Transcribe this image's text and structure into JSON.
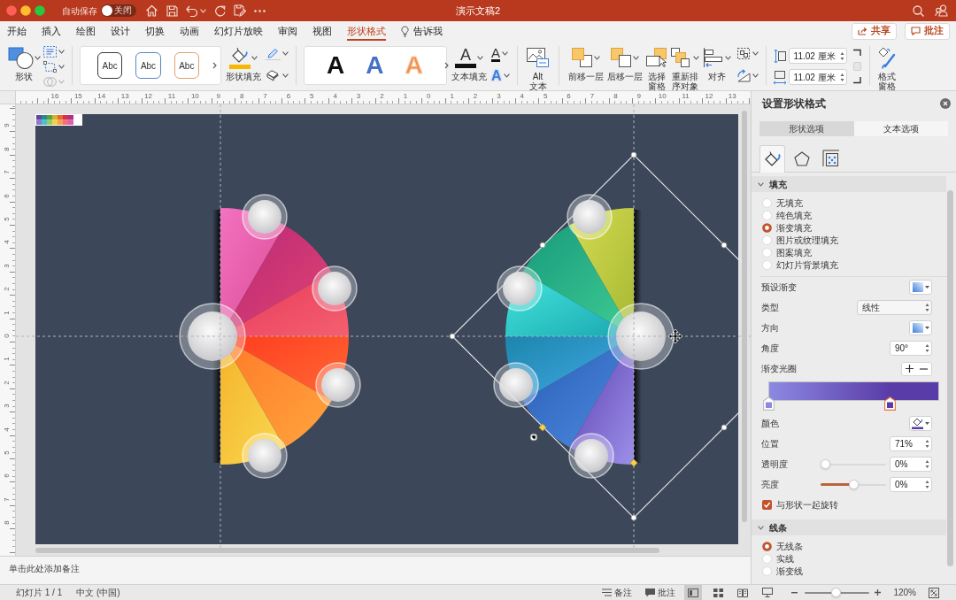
{
  "title_bar": {
    "autosave_label": "自动保存",
    "autosave": {
      "label": "关闭",
      "on": false
    },
    "title": "演示文稿2"
  },
  "tabs": [
    {
      "label": "开始",
      "selected": false
    },
    {
      "label": "插入",
      "selected": false
    },
    {
      "label": "绘图",
      "selected": false
    },
    {
      "label": "设计",
      "selected": false
    },
    {
      "label": "切换",
      "selected": false
    },
    {
      "label": "动画",
      "selected": false
    },
    {
      "label": "幻灯片放映",
      "selected": false
    },
    {
      "label": "审阅",
      "selected": false
    },
    {
      "label": "视图",
      "selected": false
    },
    {
      "label": "形状格式",
      "selected": true
    }
  ],
  "tell_me": "告诉我",
  "header_buttons": [
    {
      "kind": "share",
      "label": "共享"
    },
    {
      "kind": "comments",
      "label": "批注"
    }
  ],
  "ribbon": {
    "shapes": "形状",
    "merge_shapes": {
      "disabled": true
    },
    "shape_styles": [
      {
        "label": "Abc",
        "color": "#3a3a3a"
      },
      {
        "label": "Abc",
        "color": "#5b86c4"
      },
      {
        "label": "Abc",
        "color": "#e3a06a"
      }
    ],
    "shape_fill": "形状填充",
    "wordart": [
      {
        "label": "A",
        "kind": "solid",
        "color": "#111111"
      },
      {
        "label": "A",
        "kind": "solid",
        "color": "#4470c8"
      },
      {
        "label": "A",
        "kind": "outline",
        "color": "#ec8d4e"
      }
    ],
    "text_fill": {
      "glyph": "A",
      "label": "文本填充"
    },
    "text_outline": "A",
    "text_effects": "A",
    "alt_text": "Alt 文本",
    "arrange": [
      {
        "kind": "forward",
        "label": "前移一层"
      },
      {
        "kind": "backward",
        "label": "后移一层"
      },
      {
        "kind": "selection_pane",
        "label": "选择窗格"
      },
      {
        "kind": "reorder",
        "label": "重新排序对象"
      },
      {
        "kind": "align",
        "label": "对齐"
      }
    ],
    "height": "11.02 厘米",
    "width": "11.02 厘米",
    "format_pane": "格式窗格"
  },
  "ruler": {
    "horizontal": [
      "16",
      "15",
      "14",
      "13",
      "12",
      "11",
      "10",
      "9",
      "8",
      "7",
      "6",
      "5",
      "4",
      "3",
      "2",
      "1",
      "0",
      "1",
      "2",
      "3",
      "4",
      "5",
      "6",
      "7",
      "8",
      "9",
      "10",
      "11",
      "12",
      "13"
    ],
    "vertical": [
      "9",
      "8",
      "7",
      "6",
      "5",
      "4",
      "3",
      "2",
      "1",
      "0",
      "1",
      "2",
      "3",
      "4",
      "5",
      "6",
      "7",
      "8"
    ]
  },
  "notes": {
    "placeholder": "单击此处添加备注"
  },
  "format_pane": {
    "title": "设置形状格式",
    "tabs": [
      {
        "label": "形状选项",
        "selected": true
      },
      {
        "label": "文本选项",
        "selected": false
      }
    ],
    "icon_tabs": [
      {
        "kind": "fill",
        "selected": true
      },
      {
        "kind": "effects",
        "selected": false
      },
      {
        "kind": "size",
        "selected": false
      }
    ],
    "fill": {
      "title": "填充",
      "expanded": true,
      "options": [
        {
          "label": "无填充",
          "selected": false
        },
        {
          "label": "纯色填充",
          "selected": false
        },
        {
          "label": "渐变填充",
          "selected": true
        },
        {
          "label": "图片或纹理填充",
          "selected": false
        },
        {
          "label": "图案填充",
          "selected": false
        },
        {
          "label": "幻灯片背景填充",
          "selected": false
        }
      ],
      "preset": "预设渐变",
      "type": {
        "label": "类型",
        "value": "线性"
      },
      "direction": "方向",
      "angle": {
        "label": "角度",
        "value": "90°"
      },
      "stops_label": "渐变光圈",
      "stops": [
        {
          "level": 0,
          "color": "#8c89e2",
          "selected": false
        },
        {
          "level": 0.71,
          "color": "#5a3ca8",
          "selected": true
        }
      ],
      "color_label": "颜色",
      "position": {
        "label": "位置",
        "value": "71%"
      },
      "transparency": {
        "label": "透明度",
        "value": "0%",
        "level": 0
      },
      "brightness": {
        "label": "亮度",
        "value": "0%",
        "level": 0.5
      },
      "rotate_with_shape": {
        "label": "与形状一起旋转",
        "checked": true
      }
    },
    "line": {
      "title": "线条",
      "expanded": true,
      "options": [
        {
          "label": "无线条",
          "selected": true
        },
        {
          "label": "实线",
          "selected": false
        },
        {
          "label": "渐变线",
          "selected": false
        }
      ]
    }
  },
  "status_bar": {
    "slide": "幻灯片 1 / 1",
    "language": "中文 (中国)",
    "notes": "备注",
    "comments": "批注",
    "views": [
      {
        "kind": "normal",
        "selected": true
      },
      {
        "kind": "sorter",
        "selected": false
      },
      {
        "kind": "reading",
        "selected": false
      },
      {
        "kind": "slideshow",
        "selected": false
      }
    ],
    "zoom": {
      "level": 0.48,
      "reading": "120%"
    }
  }
}
